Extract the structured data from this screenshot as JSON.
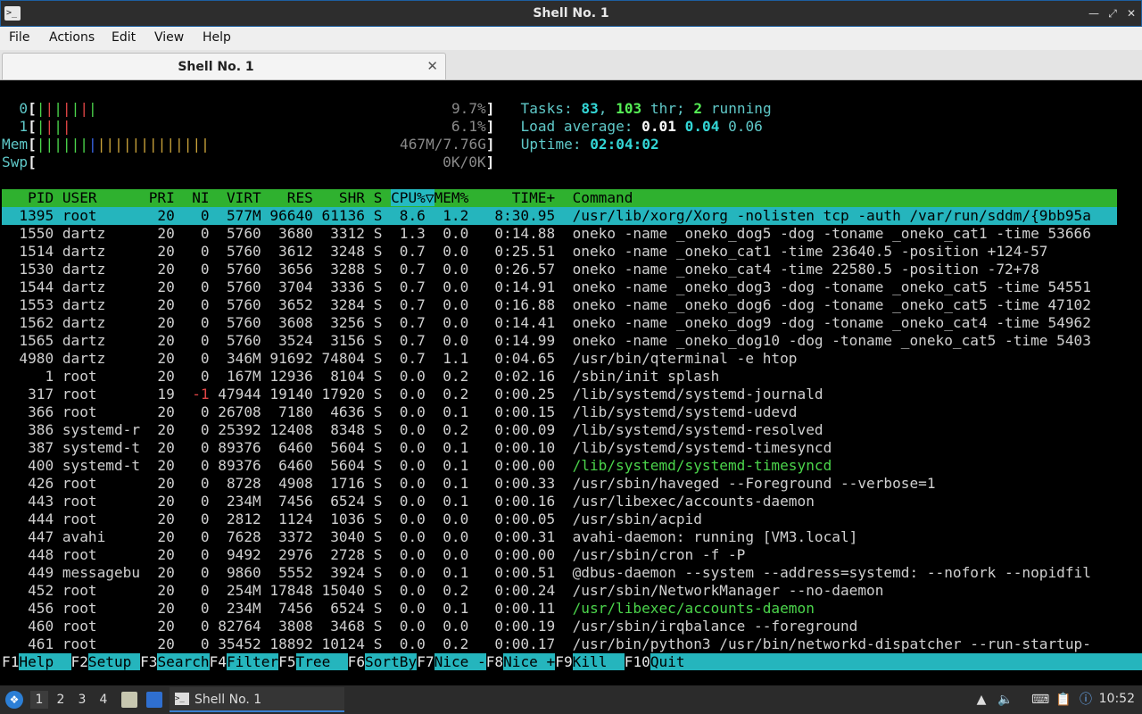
{
  "window": {
    "title": "Shell No. 1"
  },
  "menu": [
    "File",
    "Actions",
    "Edit",
    "View",
    "Help"
  ],
  "tab": {
    "label": "Shell No. 1"
  },
  "htop": {
    "cpu0": {
      "label": "0",
      "bars": "|||||||",
      "value": "9.7%"
    },
    "cpu1": {
      "label": "1",
      "bars": "||||",
      "value": "6.1%"
    },
    "mem": {
      "label": "Mem",
      "bars": "||||||||||||||||||||",
      "value": "467M/7.76G"
    },
    "swp": {
      "label": "Swp",
      "value": "0K/0K"
    },
    "tasks": {
      "label": "Tasks:",
      "count": "83",
      "threads": "103",
      "thr_label": "thr;",
      "running": "2",
      "running_label": "running"
    },
    "load": {
      "label": "Load average:",
      "l1": "0.01",
      "l5": "0.04",
      "l15": "0.06"
    },
    "uptime": {
      "label": "Uptime:",
      "value": "02:04:02"
    },
    "columns": {
      "pid": "PID",
      "user": "USER",
      "pri": "PRI",
      "ni": "NI",
      "virt": "VIRT",
      "res": "RES",
      "shr": "SHR",
      "s": "S",
      "cpu": "CPU%▽",
      "mem": "MEM%",
      "time": "TIME+",
      "cmd": "Command"
    },
    "processes": [
      {
        "pid": "1395",
        "user": "root",
        "pri": "20",
        "ni": "0",
        "virt": "577M",
        "res": "96640",
        "shr": "61136",
        "s": "S",
        "cpu": "8.6",
        "mem": "1.2",
        "time": "8:30.95",
        "cmd": "/usr/lib/xorg/Xorg -nolisten tcp -auth /var/run/sddm/{9bb95a"
      },
      {
        "pid": "1550",
        "user": "dartz",
        "pri": "20",
        "ni": "0",
        "virt": "5760",
        "res": "3680",
        "shr": "3312",
        "s": "S",
        "cpu": "1.3",
        "mem": "0.0",
        "time": "0:14.88",
        "cmd": "oneko -name _oneko_dog5 -dog -toname _oneko_cat1 -time 53666"
      },
      {
        "pid": "1514",
        "user": "dartz",
        "pri": "20",
        "ni": "0",
        "virt": "5760",
        "res": "3612",
        "shr": "3248",
        "s": "S",
        "cpu": "0.7",
        "mem": "0.0",
        "time": "0:25.51",
        "cmd": "oneko -name _oneko_cat1 -time 23640.5 -position +124-57"
      },
      {
        "pid": "1530",
        "user": "dartz",
        "pri": "20",
        "ni": "0",
        "virt": "5760",
        "res": "3656",
        "shr": "3288",
        "s": "S",
        "cpu": "0.7",
        "mem": "0.0",
        "time": "0:26.57",
        "cmd": "oneko -name _oneko_cat4 -time 22580.5 -position -72+78"
      },
      {
        "pid": "1544",
        "user": "dartz",
        "pri": "20",
        "ni": "0",
        "virt": "5760",
        "res": "3704",
        "shr": "3336",
        "s": "S",
        "cpu": "0.7",
        "mem": "0.0",
        "time": "0:14.91",
        "cmd": "oneko -name _oneko_dog3 -dog -toname _oneko_cat5 -time 54551"
      },
      {
        "pid": "1553",
        "user": "dartz",
        "pri": "20",
        "ni": "0",
        "virt": "5760",
        "res": "3652",
        "shr": "3284",
        "s": "S",
        "cpu": "0.7",
        "mem": "0.0",
        "time": "0:16.88",
        "cmd": "oneko -name _oneko_dog6 -dog -toname _oneko_cat5 -time 47102"
      },
      {
        "pid": "1562",
        "user": "dartz",
        "pri": "20",
        "ni": "0",
        "virt": "5760",
        "res": "3608",
        "shr": "3256",
        "s": "S",
        "cpu": "0.7",
        "mem": "0.0",
        "time": "0:14.41",
        "cmd": "oneko -name _oneko_dog9 -dog -toname _oneko_cat4 -time 54962"
      },
      {
        "pid": "1565",
        "user": "dartz",
        "pri": "20",
        "ni": "0",
        "virt": "5760",
        "res": "3524",
        "shr": "3156",
        "s": "S",
        "cpu": "0.7",
        "mem": "0.0",
        "time": "0:14.99",
        "cmd": "oneko -name _oneko_dog10 -dog -toname _oneko_cat5 -time 5403"
      },
      {
        "pid": "4980",
        "user": "dartz",
        "pri": "20",
        "ni": "0",
        "virt": "346M",
        "res": "91692",
        "shr": "74804",
        "s": "S",
        "cpu": "0.7",
        "mem": "1.1",
        "time": "0:04.65",
        "cmd": "/usr/bin/qterminal -e htop"
      },
      {
        "pid": "1",
        "user": "root",
        "pri": "20",
        "ni": "0",
        "virt": "167M",
        "res": "12936",
        "shr": "8104",
        "s": "S",
        "cpu": "0.0",
        "mem": "0.2",
        "time": "0:02.16",
        "cmd": "/sbin/init splash"
      },
      {
        "pid": "317",
        "user": "root",
        "pri": "19",
        "ni": "-1",
        "virt": "47944",
        "res": "19140",
        "shr": "17920",
        "s": "S",
        "cpu": "0.0",
        "mem": "0.2",
        "time": "0:00.25",
        "cmd": "/lib/systemd/systemd-journald"
      },
      {
        "pid": "366",
        "user": "root",
        "pri": "20",
        "ni": "0",
        "virt": "26708",
        "res": "7180",
        "shr": "4636",
        "s": "S",
        "cpu": "0.0",
        "mem": "0.1",
        "time": "0:00.15",
        "cmd": "/lib/systemd/systemd-udevd"
      },
      {
        "pid": "386",
        "user": "systemd-r",
        "pri": "20",
        "ni": "0",
        "virt": "25392",
        "res": "12408",
        "shr": "8348",
        "s": "S",
        "cpu": "0.0",
        "mem": "0.2",
        "time": "0:00.09",
        "cmd": "/lib/systemd/systemd-resolved"
      },
      {
        "pid": "387",
        "user": "systemd-t",
        "pri": "20",
        "ni": "0",
        "virt": "89376",
        "res": "6460",
        "shr": "5604",
        "s": "S",
        "cpu": "0.0",
        "mem": "0.1",
        "time": "0:00.10",
        "cmd": "/lib/systemd/systemd-timesyncd"
      },
      {
        "pid": "400",
        "user": "systemd-t",
        "pri": "20",
        "ni": "0",
        "virt": "89376",
        "res": "6460",
        "shr": "5604",
        "s": "S",
        "cpu": "0.0",
        "mem": "0.1",
        "time": "0:00.00",
        "cmd": "/lib/systemd/systemd-timesyncd",
        "thread": true
      },
      {
        "pid": "426",
        "user": "root",
        "pri": "20",
        "ni": "0",
        "virt": "8728",
        "res": "4908",
        "shr": "1716",
        "s": "S",
        "cpu": "0.0",
        "mem": "0.1",
        "time": "0:00.33",
        "cmd": "/usr/sbin/haveged --Foreground --verbose=1"
      },
      {
        "pid": "443",
        "user": "root",
        "pri": "20",
        "ni": "0",
        "virt": "234M",
        "res": "7456",
        "shr": "6524",
        "s": "S",
        "cpu": "0.0",
        "mem": "0.1",
        "time": "0:00.16",
        "cmd": "/usr/libexec/accounts-daemon"
      },
      {
        "pid": "444",
        "user": "root",
        "pri": "20",
        "ni": "0",
        "virt": "2812",
        "res": "1124",
        "shr": "1036",
        "s": "S",
        "cpu": "0.0",
        "mem": "0.0",
        "time": "0:00.05",
        "cmd": "/usr/sbin/acpid"
      },
      {
        "pid": "447",
        "user": "avahi",
        "pri": "20",
        "ni": "0",
        "virt": "7628",
        "res": "3372",
        "shr": "3040",
        "s": "S",
        "cpu": "0.0",
        "mem": "0.0",
        "time": "0:00.31",
        "cmd": "avahi-daemon: running [VM3.local]"
      },
      {
        "pid": "448",
        "user": "root",
        "pri": "20",
        "ni": "0",
        "virt": "9492",
        "res": "2976",
        "shr": "2728",
        "s": "S",
        "cpu": "0.0",
        "mem": "0.0",
        "time": "0:00.00",
        "cmd": "/usr/sbin/cron -f -P"
      },
      {
        "pid": "449",
        "user": "messagebu",
        "pri": "20",
        "ni": "0",
        "virt": "9860",
        "res": "5552",
        "shr": "3924",
        "s": "S",
        "cpu": "0.0",
        "mem": "0.1",
        "time": "0:00.51",
        "cmd": "@dbus-daemon --system --address=systemd: --nofork --nopidfil"
      },
      {
        "pid": "452",
        "user": "root",
        "pri": "20",
        "ni": "0",
        "virt": "254M",
        "res": "17848",
        "shr": "15040",
        "s": "S",
        "cpu": "0.0",
        "mem": "0.2",
        "time": "0:00.24",
        "cmd": "/usr/sbin/NetworkManager --no-daemon"
      },
      {
        "pid": "456",
        "user": "root",
        "pri": "20",
        "ni": "0",
        "virt": "234M",
        "res": "7456",
        "shr": "6524",
        "s": "S",
        "cpu": "0.0",
        "mem": "0.1",
        "time": "0:00.11",
        "cmd": "/usr/libexec/accounts-daemon",
        "thread": true
      },
      {
        "pid": "460",
        "user": "root",
        "pri": "20",
        "ni": "0",
        "virt": "82764",
        "res": "3808",
        "shr": "3468",
        "s": "S",
        "cpu": "0.0",
        "mem": "0.0",
        "time": "0:00.19",
        "cmd": "/usr/sbin/irqbalance --foreground"
      },
      {
        "pid": "461",
        "user": "root",
        "pri": "20",
        "ni": "0",
        "virt": "35452",
        "res": "18892",
        "shr": "10124",
        "s": "S",
        "cpu": "0.0",
        "mem": "0.2",
        "time": "0:00.17",
        "cmd": "/usr/bin/python3 /usr/bin/networkd-dispatcher --run-startup-"
      }
    ],
    "fkeys": [
      {
        "key": "F1",
        "label": "Help  "
      },
      {
        "key": "F2",
        "label": "Setup "
      },
      {
        "key": "F3",
        "label": "Search"
      },
      {
        "key": "F4",
        "label": "Filter"
      },
      {
        "key": "F5",
        "label": "Tree  "
      },
      {
        "key": "F6",
        "label": "SortBy"
      },
      {
        "key": "F7",
        "label": "Nice -"
      },
      {
        "key": "F8",
        "label": "Nice +"
      },
      {
        "key": "F9",
        "label": "Kill  "
      },
      {
        "key": "F10",
        "label": "Quit"
      }
    ]
  },
  "taskbar": {
    "workspaces": [
      "1",
      "2",
      "3",
      "4"
    ],
    "task": "Shell No. 1",
    "clock": "10:52"
  },
  "colors": {
    "header_bg": "#2fb12f",
    "selection_bg": "#25b5bd",
    "accent": "#3b7fd1"
  }
}
